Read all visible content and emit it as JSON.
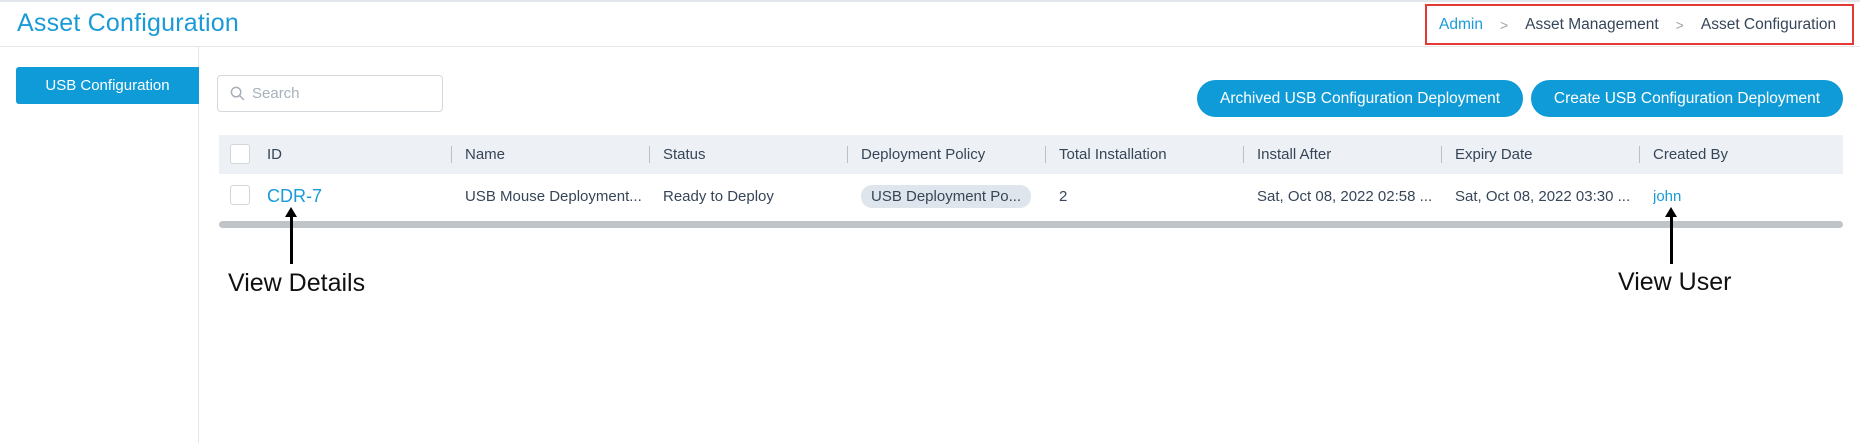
{
  "header": {
    "title": "Asset Configuration",
    "breadcrumb": [
      "Admin",
      "Asset Management",
      "Asset Configuration"
    ],
    "separator": ">"
  },
  "sidebar": {
    "items": [
      {
        "label": "USB Configuration",
        "active": true
      }
    ]
  },
  "search": {
    "placeholder": "Search",
    "value": ""
  },
  "actions": {
    "archived_label": "Archived USB Configuration Deployment",
    "create_label": "Create USB Configuration Deployment"
  },
  "table": {
    "columns": [
      "ID",
      "Name",
      "Status",
      "Deployment Policy",
      "Total Installation",
      "Install After",
      "Expiry Date",
      "Created By"
    ],
    "rows": [
      {
        "id": "CDR-7",
        "name": "USB Mouse Deployment...",
        "status": "Ready to Deploy",
        "deployment_policy": "USB Deployment Po...",
        "total_installation": "2",
        "install_after": "Sat, Oct 08, 2022 02:58 ...",
        "expiry_date": "Sat, Oct 08, 2022 03:30 ...",
        "created_by": "john"
      }
    ]
  },
  "annotations": {
    "view_details": "View Details",
    "view_user": "View User"
  },
  "colors": {
    "accent": "#0f9bd7",
    "link": "#1a9bd7",
    "highlight_border": "#e53935",
    "header_bg": "#edf0f4"
  }
}
